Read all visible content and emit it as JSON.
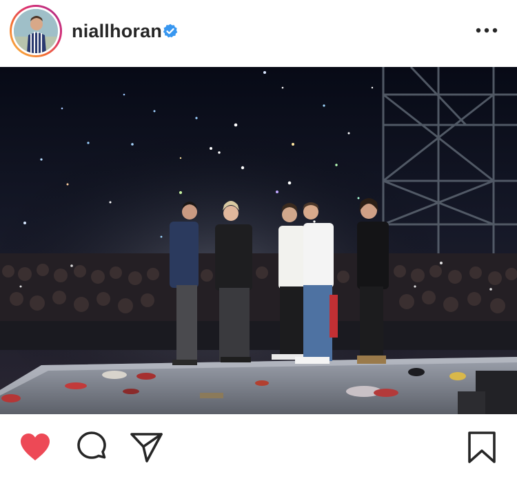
{
  "post": {
    "username": "niallhoran",
    "verified": true,
    "liked": true
  },
  "icons": {
    "verified": "verified-badge-icon",
    "more": "more-options-icon",
    "like": "heart-icon",
    "comment": "comment-icon",
    "share": "share-icon",
    "save": "bookmark-icon"
  },
  "colors": {
    "like": "#ed4956",
    "verified": "#3897f0",
    "text": "#262626"
  }
}
